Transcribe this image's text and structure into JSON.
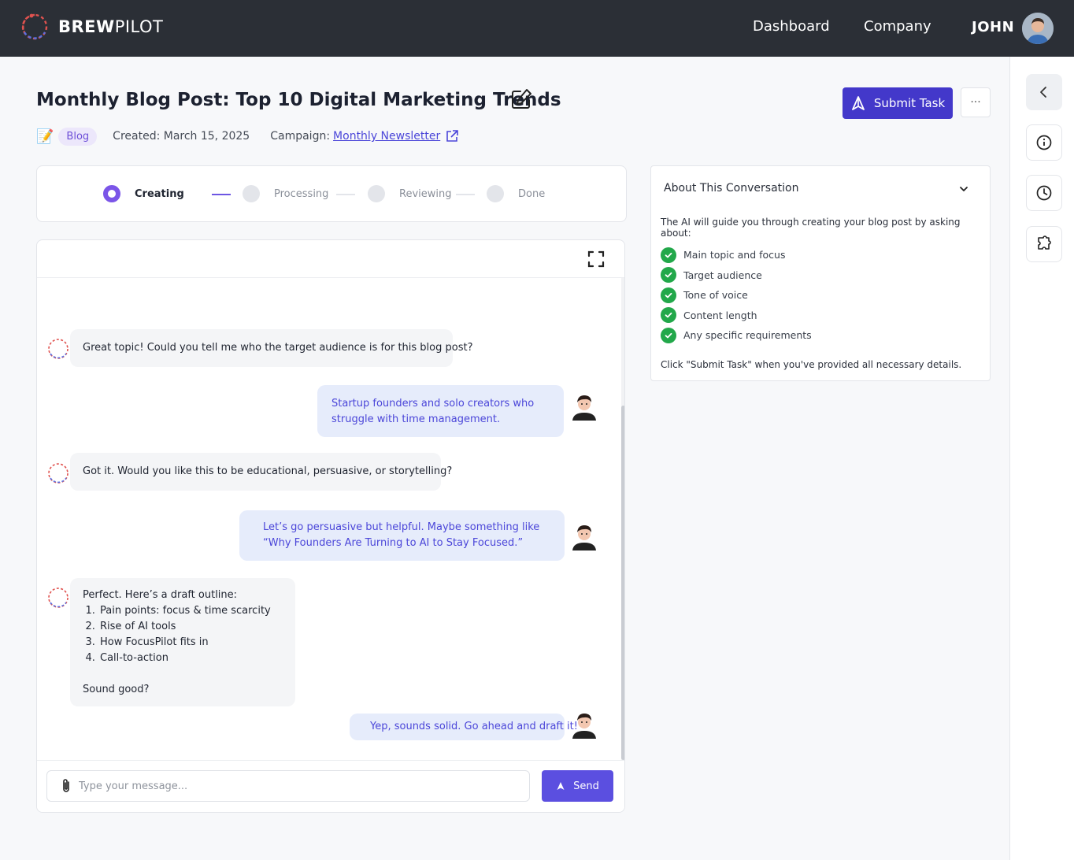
{
  "header": {
    "brand_bold": "BREW",
    "brand_light": "PILOT",
    "nav": [
      "Dashboard",
      "Company"
    ],
    "user": "JOHN"
  },
  "task": {
    "title": "Monthly Blog Post: Top 10 Digital Marketing Trends",
    "emoji": "📝",
    "badge": "Blog",
    "created": "Created: March 15, 2025",
    "campaign_label": "Campaign:",
    "campaign_link": "Monthly Newsletter",
    "submit_label": "Submit Task",
    "more_label": "···"
  },
  "stepper": {
    "steps": [
      "Creating",
      "Processing",
      "Reviewing",
      "Done"
    ],
    "active_index": 0
  },
  "chat": {
    "messages": [
      {
        "role": "bot",
        "text": "Great topic! Could you tell me who the target audience is for this blog post?"
      },
      {
        "role": "user",
        "text": "Startup founders and solo creators who struggle with time management."
      },
      {
        "role": "bot",
        "text": "Got it. Would you like this to be educational, persuasive, or storytelling?"
      },
      {
        "role": "user",
        "text": "Let’s go persuasive but helpful. Maybe something like “Why Founders Are Turning to AI to Stay Focused.”"
      },
      {
        "role": "bot",
        "intro": "Perfect. Here’s a draft outline:",
        "list": [
          "Pain points: focus & time scarcity",
          "Rise of AI tools",
          "How FocusPilot fits in",
          "Call-to-action"
        ],
        "outro": "Sound good?"
      },
      {
        "role": "user",
        "text": "Yep, sounds solid. Go ahead and draft it!"
      }
    ],
    "input_placeholder": "Type your message...",
    "send_label": "Send"
  },
  "about": {
    "title": "About This Conversation",
    "intro": "The AI will guide you through creating your blog post by asking about:",
    "items": [
      "Main topic and focus",
      "Target audience",
      "Tone of voice",
      "Content length",
      "Any specific requirements"
    ],
    "footer": "Click \"Submit Task\" when you've provided all necessary details."
  },
  "colors": {
    "header_bg": "#2b2f36",
    "accent": "#4338ca",
    "stepper_active": "#7b55e8",
    "check_green": "#22a84a",
    "user_bubble": "#e6ecfb"
  },
  "icons": {
    "logo": "brewpilot-logo",
    "edit": "edit-icon",
    "external": "external-link-icon",
    "rail": [
      "chevron-left-icon",
      "info-icon",
      "clock-icon",
      "puzzle-icon"
    ]
  }
}
